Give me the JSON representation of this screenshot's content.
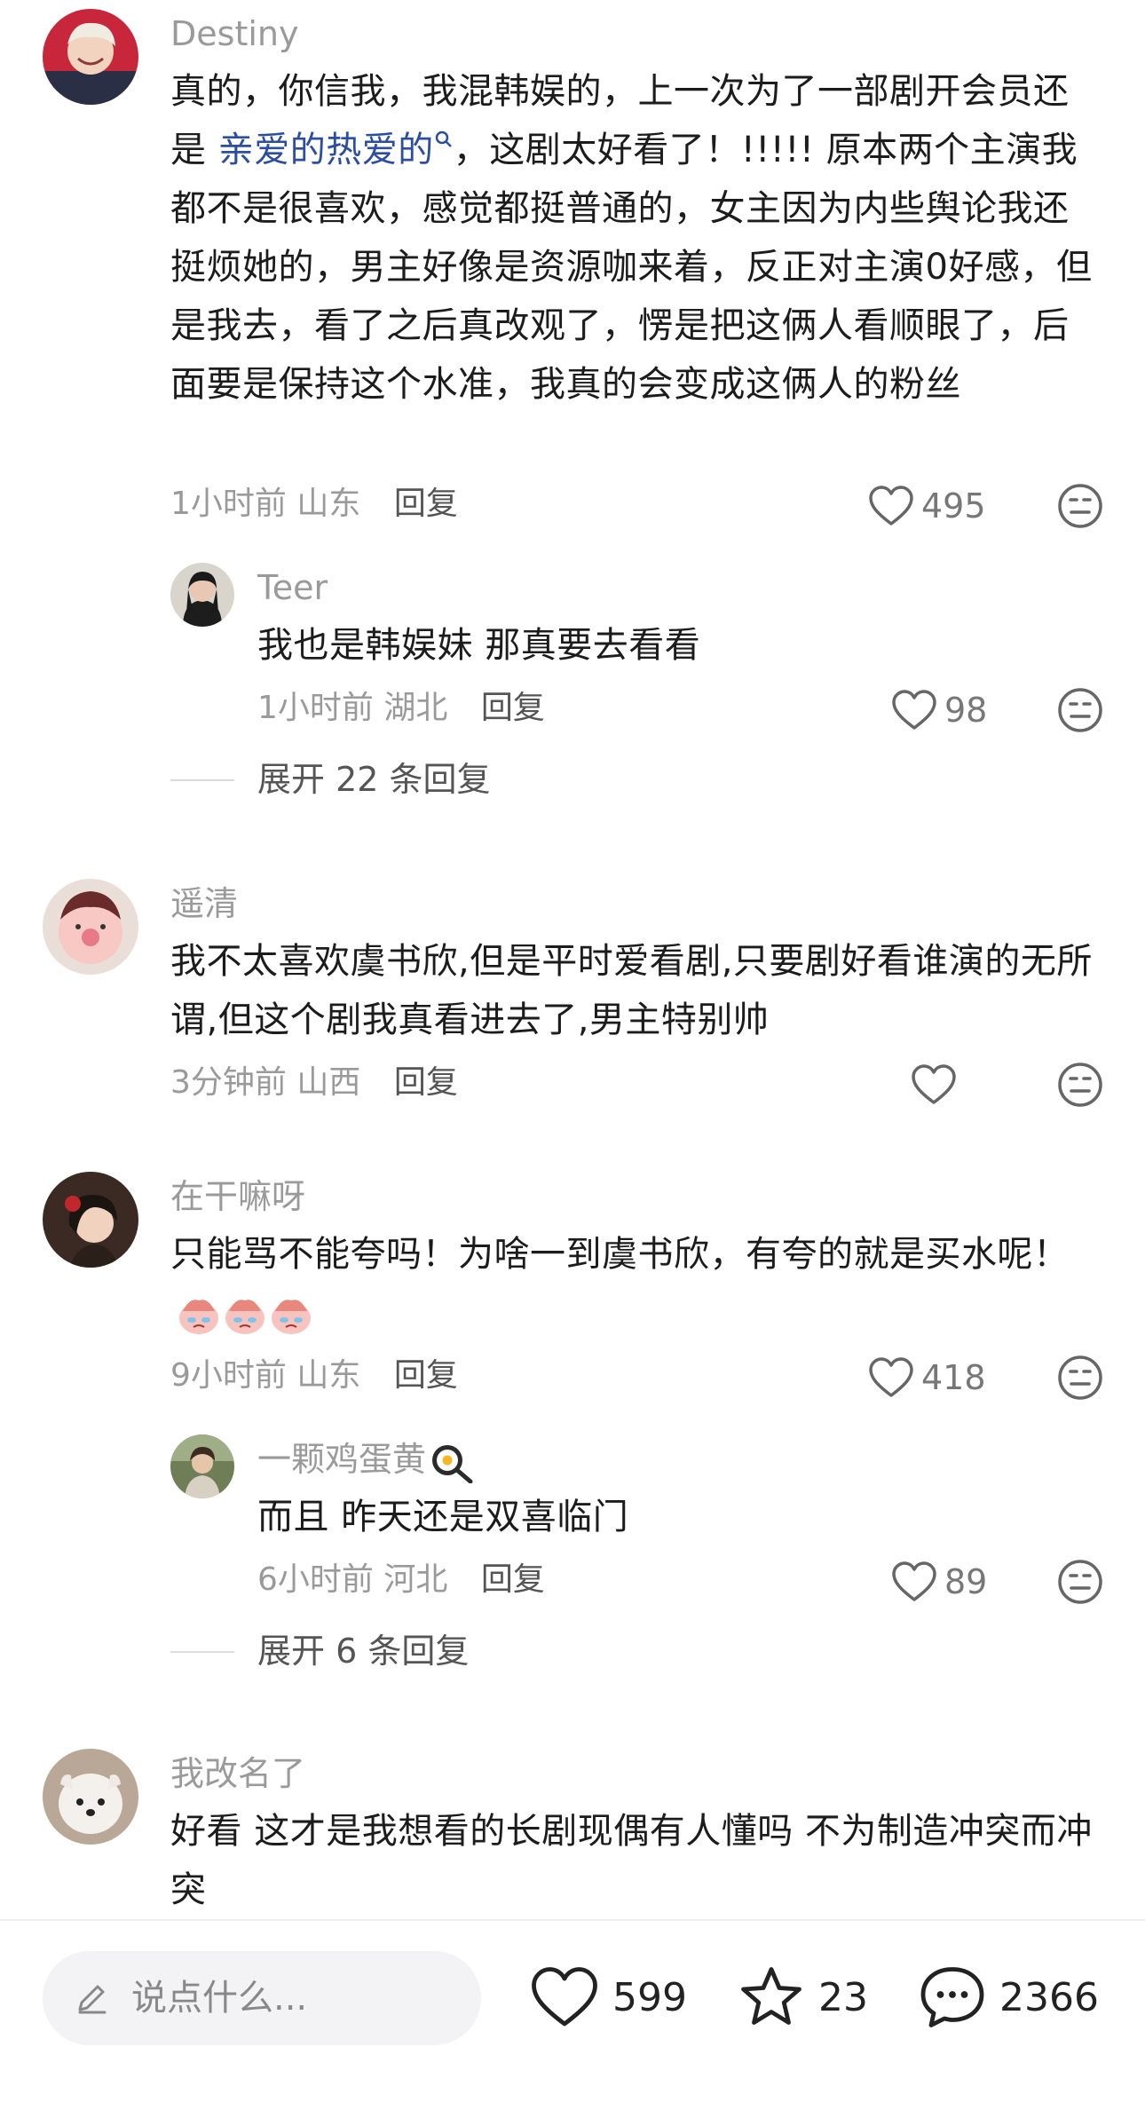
{
  "comments": [
    {
      "username": "Destiny",
      "text_before": "真的，你信我，我混韩娱的，上一次为了一部剧开会员还是 ",
      "mention": "亲爱的热爱的",
      "text_after": "，这剧太好看了！!!!!!  原本两个主演我都不是很喜欢，感觉都挺普通的，女主因为内些舆论我还挺烦她的，男主好像是资源咖来着，反正对主演0好感，但是我去，看了之后真改观了，愣是把这俩人看顺眼了，后面要是保持这个水准，我真的会变成这俩人的粉丝",
      "time": "1小时前",
      "location": "山东",
      "reply_label": "回复",
      "likes": "495",
      "replies": [
        {
          "username": "Teer",
          "text": "我也是韩娱妹 那真要去看看",
          "time": "1小时前",
          "location": "湖北",
          "reply_label": "回复",
          "likes": "98"
        }
      ],
      "expand_label": "展开 22 条回复"
    },
    {
      "username": "遥清",
      "text": "我不太喜欢虞书欣,但是平时爱看剧,只要剧好看谁演的无所谓,但这个剧我真看进去了,男主特别帅",
      "time": "3分钟前",
      "location": "山西",
      "reply_label": "回复",
      "likes": ""
    },
    {
      "username": "在干嘛呀",
      "text": "只能骂不能夸吗！为啥一到虞书欣，有夸的就是买水呢！",
      "time": "9小时前",
      "location": "山东",
      "reply_label": "回复",
      "likes": "418",
      "replies": [
        {
          "username": "一颗鸡蛋黄",
          "text": "而且  昨天还是双喜临门",
          "time": "6小时前",
          "location": "河北",
          "reply_label": "回复",
          "likes": "89"
        }
      ],
      "expand_label": "展开 6 条回复"
    },
    {
      "username": "我改名了",
      "text": "好看 这才是我想看的长剧现偶有人懂吗 不为制造冲突而冲突"
    }
  ],
  "bottom_bar": {
    "input_placeholder": "说点什么...",
    "likes": "599",
    "favorites": "23",
    "comments": "2366"
  },
  "icons": {
    "like": "heart-outline-icon",
    "dislike": "neutral-face-icon",
    "favorite": "star-outline-icon",
    "comment": "chat-bubble-icon",
    "edit": "pencil-icon"
  },
  "colors": {
    "mention": "#2b4ea3",
    "secondary_text": "#9a9a9a",
    "primary_text": "#1c1c1c"
  }
}
